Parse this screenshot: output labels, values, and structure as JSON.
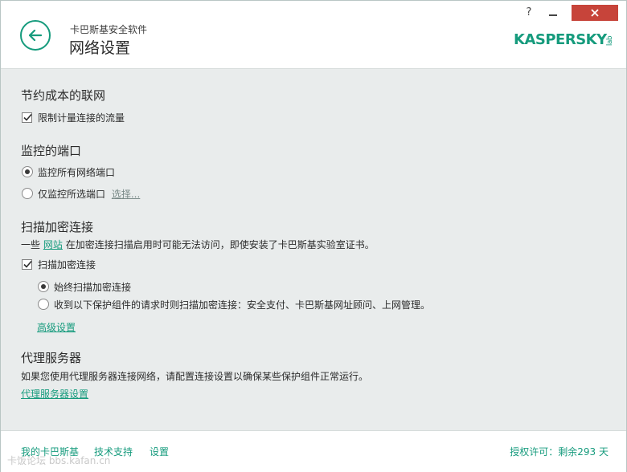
{
  "header": {
    "app_name": "卡巴斯基安全软件",
    "page_title": "网络设置",
    "help_label": "?",
    "logo_text": "KASPERSKY",
    "logo_suffix": "lab"
  },
  "sections": {
    "save_cost": {
      "title": "节约成本的联网",
      "limit_traffic_label": "限制计量连接的流量",
      "limit_traffic_checked": true
    },
    "monitored_ports": {
      "title": "监控的端口",
      "all_ports_label": "监控所有网络端口",
      "selected_ports_label": "仅监控所选端口",
      "select_link": "选择...",
      "selected": "all_ports"
    },
    "encrypted": {
      "title": "扫描加密连接",
      "desc_prefix": "一些",
      "desc_link": "网站",
      "desc_suffix": "在加密连接扫描启用时可能无法访问，即使安装了卡巴斯基实验室证书。",
      "scan_label": "扫描加密连接",
      "scan_checked": true,
      "always_label": "始终扫描加密连接",
      "on_request_label": "收到以下保护组件的请求时则扫描加密连接：安全支付、卡巴斯基网址顾问、上网管理。",
      "selected": "always",
      "advanced_link": "高级设置"
    },
    "proxy": {
      "title": "代理服务器",
      "desc": "如果您使用代理服务器连接网络，请配置连接设置以确保某些保护组件正常运行。",
      "settings_link": "代理服务器设置"
    }
  },
  "footer": {
    "my_kaspersky": "我的卡巴斯基",
    "support": "技术支持",
    "settings": "设置",
    "license": "授权许可：剩余293 天",
    "watermark": "卡饭论坛 bbs.kafan.cn"
  },
  "colors": {
    "accent": "#169b7d",
    "content_bg": "#e9ecec",
    "close_red": "#c7443a"
  }
}
